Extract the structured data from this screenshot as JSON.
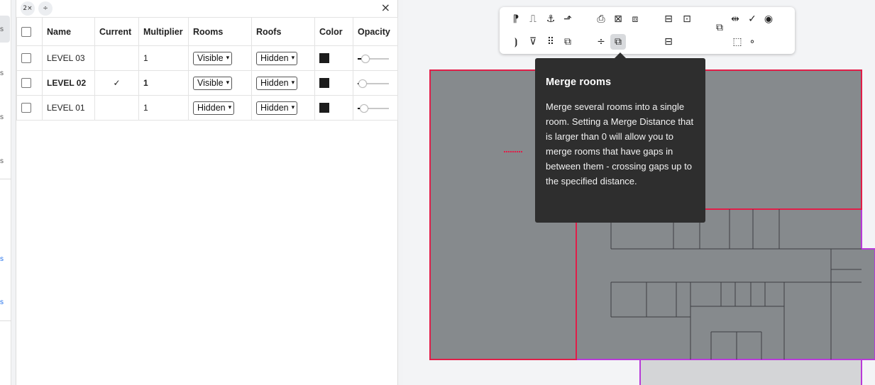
{
  "left_strip": {
    "fragments": [
      "s",
      "s",
      "s",
      "s",
      "s",
      "s"
    ]
  },
  "panel": {
    "toolbar": {
      "multiplier_btn": "2×",
      "spacing_btn": "÷",
      "close": "×"
    },
    "columns": [
      "",
      "Name",
      "Current",
      "Multiplier",
      "Rooms",
      "Roofs",
      "Color",
      "Opacity"
    ],
    "rows": [
      {
        "name": "LEVEL 03",
        "current": "",
        "multiplier": "1",
        "rooms": "Visible",
        "roofs": "Hidden",
        "color": "#1c1c1c",
        "opacity": 0.25,
        "bold": false
      },
      {
        "name": "LEVEL 02",
        "current": "✓",
        "multiplier": "1",
        "rooms": "Visible",
        "roofs": "Hidden",
        "color": "#1c1c1c",
        "opacity": 0.15,
        "bold": true
      },
      {
        "name": "LEVEL 01",
        "current": "",
        "multiplier": "1",
        "rooms": "Hidden",
        "roofs": "Hidden",
        "color": "#1c1c1c",
        "opacity": 0.2,
        "bold": false
      }
    ]
  },
  "palette": {
    "tools": [
      {
        "name": "label-area-tool-icon",
        "glyph": "⁋"
      },
      {
        "name": "step-line-tool-icon",
        "glyph": "⎍"
      },
      {
        "name": "anchor-tool-icon",
        "glyph": "⚓"
      },
      {
        "name": "corner-arrow-tool-icon",
        "glyph": "⬏"
      },
      {
        "name": "print-layout-tool-icon",
        "glyph": "⎙"
      },
      {
        "name": "crossed-box-tool-icon",
        "glyph": "⊠"
      },
      {
        "name": "inset-box-tool-icon",
        "glyph": "⧈"
      },
      {
        "name": "split-window-tool-icon",
        "glyph": "⊟"
      },
      {
        "name": "center-square-tool-icon",
        "glyph": "⊡"
      },
      {
        "name": "overlap-squares-tool-icon",
        "glyph": "⧉"
      },
      {
        "name": "align-center-tool-icon",
        "glyph": "⇹"
      },
      {
        "name": "check-tool-icon",
        "glyph": "✓"
      },
      {
        "name": "eye-tool-icon",
        "glyph": "◉"
      },
      {
        "name": "bracket-split-tool-icon",
        "glyph": "⦘"
      },
      {
        "name": "lamp-tool-icon",
        "glyph": "⊽"
      },
      {
        "name": "grid-dots-tool-icon",
        "glyph": "⠿"
      },
      {
        "name": "overlap-box-tool-icon",
        "glyph": "⧉"
      },
      {
        "name": "distribute-tool-icon",
        "glyph": "÷"
      },
      {
        "name": "merge-rooms-tool-icon",
        "glyph": "⧉"
      },
      {
        "name": "minus-box-tool-icon",
        "glyph": "⊟"
      },
      {
        "name": "dotted-box-tool-icon",
        "glyph": "⬚"
      },
      {
        "name": "circle-tool-icon",
        "glyph": "∘"
      }
    ]
  },
  "tooltip": {
    "title": "Merge rooms",
    "body": "Merge several rooms into a single room. Setting a Merge Distance that is larger than 0 will allow you to merge rooms that have gaps in between them - crossing gaps up to the specified distance."
  },
  "colors": {
    "room_fill": "#868a8d",
    "room_outline_red": "#e11d48",
    "room_outline_purple": "#b83ad8",
    "light_room": "#d4d5d7",
    "tooltip_bg": "#2e2e2e"
  }
}
